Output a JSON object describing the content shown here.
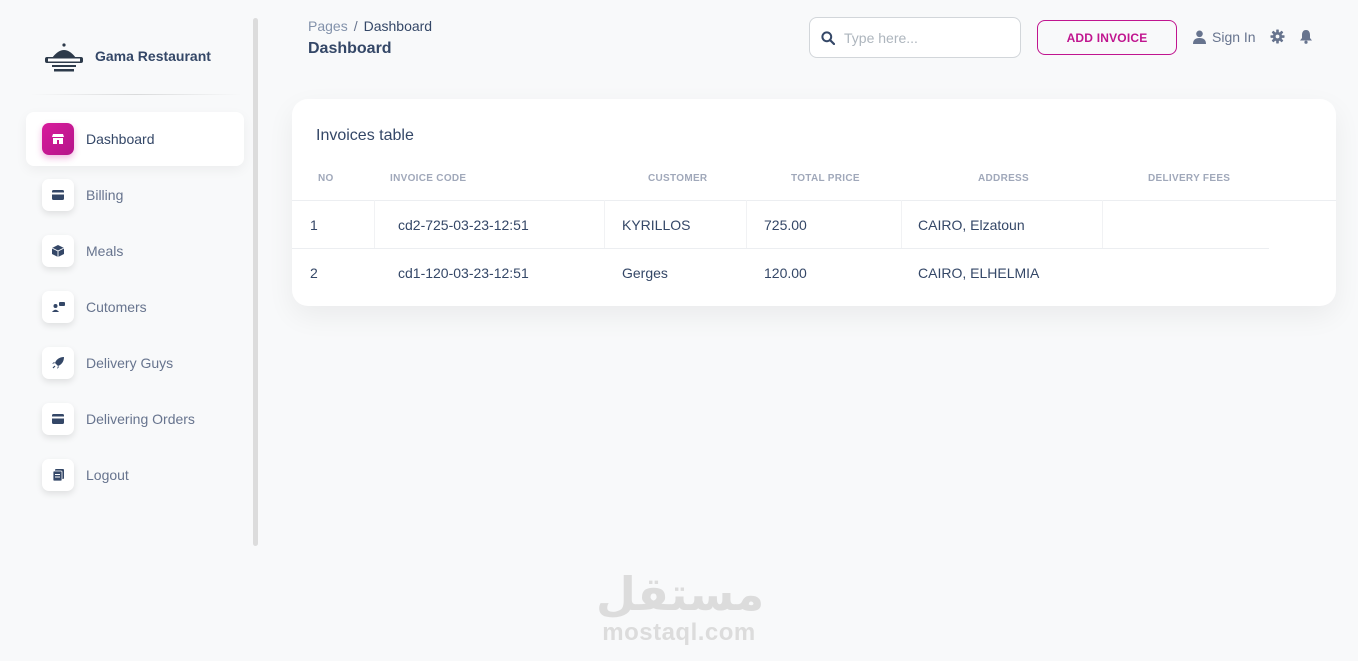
{
  "brand": {
    "name": "Gama Restaurant",
    "logo_icon": "restaurant-cloche-logo"
  },
  "nav": [
    {
      "label": "Dashboard",
      "icon": "store-icon",
      "active": true
    },
    {
      "label": "Billing",
      "icon": "credit-card-icon",
      "active": false
    },
    {
      "label": "Meals",
      "icon": "box-icon",
      "active": false
    },
    {
      "label": "Cutomers",
      "icon": "users-icon",
      "active": false
    },
    {
      "label": "Delivery Guys",
      "icon": "rocket-icon",
      "active": false
    },
    {
      "label": "Delivering Orders",
      "icon": "credit-card-icon",
      "active": false
    },
    {
      "label": "Logout",
      "icon": "document-icon",
      "active": false
    }
  ],
  "header": {
    "breadcrumb_root": "Pages",
    "breadcrumb_separator": "/",
    "breadcrumb_current": "Dashboard",
    "title": "Dashboard",
    "search_placeholder": "Type here...",
    "add_invoice_label": "ADD INVOICE",
    "sign_in_label": "Sign In"
  },
  "invoices": {
    "title": "Invoices table",
    "columns": [
      "NO",
      "INVOICE CODE",
      "CUSTOMER",
      "TOTAL PRICE",
      "ADDRESS",
      "DELIVERY FEES"
    ],
    "rows": [
      {
        "no": "1",
        "code": "cd2-725-03-23-12:51",
        "customer": "KYRILLOS",
        "total": "725.00",
        "address": "CAIRO, Elzatoun",
        "fees": ""
      },
      {
        "no": "2",
        "code": "cd1-120-03-23-12:51",
        "customer": "Gerges",
        "total": "120.00",
        "address": "CAIRO, ELHELMIA",
        "fees": ""
      }
    ]
  },
  "watermark": {
    "arabic": "مستقل",
    "latin": "mostaql.com"
  },
  "colors": {
    "accent": "#c0158f",
    "text": "#344767",
    "muted": "#67748e"
  }
}
